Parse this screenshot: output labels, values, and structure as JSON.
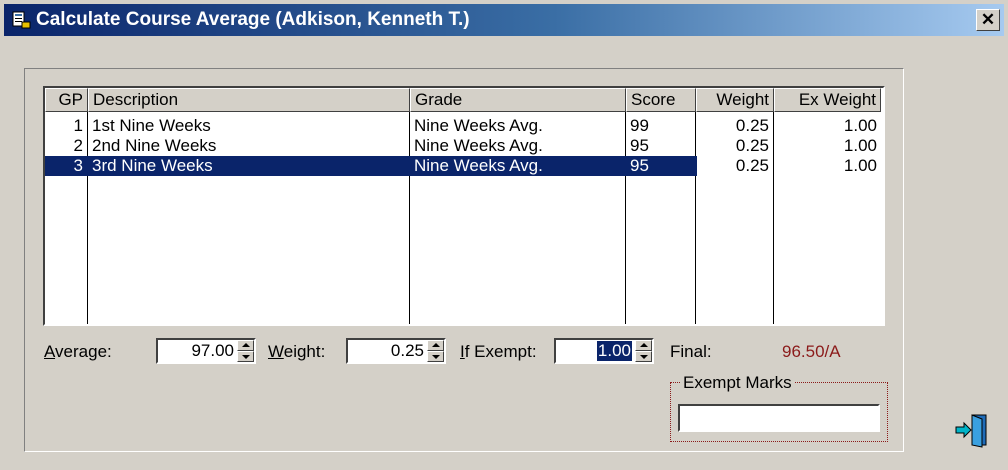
{
  "window": {
    "title": "Calculate Course Average (Adkison, Kenneth T.)",
    "close_label": "✕"
  },
  "grid": {
    "headers": {
      "gp": "GP",
      "description": "Description",
      "grade": "Grade",
      "score": "Score",
      "weight": "Weight",
      "ex_weight": "Ex Weight"
    },
    "rows": [
      {
        "gp": "1",
        "description": "1st Nine Weeks",
        "grade": "Nine Weeks Avg.",
        "score": "99",
        "weight": "0.25",
        "ex_weight": "1.00"
      },
      {
        "gp": "2",
        "description": "2nd Nine Weeks",
        "grade": "Nine Weeks Avg.",
        "score": "95",
        "weight": "0.25",
        "ex_weight": "1.00"
      },
      {
        "gp": "3",
        "description": "3rd Nine Weeks",
        "grade": "Nine Weeks Avg.",
        "score": "95",
        "weight": "0.25",
        "ex_weight": "1.00"
      }
    ],
    "selected_row": 3
  },
  "controls": {
    "average_label_underline": "A",
    "average_label_rest": "verage:",
    "average_value": "97.00",
    "weight_label_underline": "W",
    "weight_label_rest": "eight:",
    "weight_value": "0.25",
    "if_exempt_label_underline": "I",
    "if_exempt_label_rest": "f Exempt:",
    "if_exempt_value": "1.00",
    "final_label": "Final:",
    "final_value": "96.50/A"
  },
  "exempt_marks": {
    "label": "Exempt Marks",
    "value": ""
  },
  "icons": {
    "title_icon": "app-icon",
    "exit_icon": "exit-door-icon"
  },
  "colors": {
    "selection": "#0a246a",
    "final_value": "#8b1a1a"
  }
}
